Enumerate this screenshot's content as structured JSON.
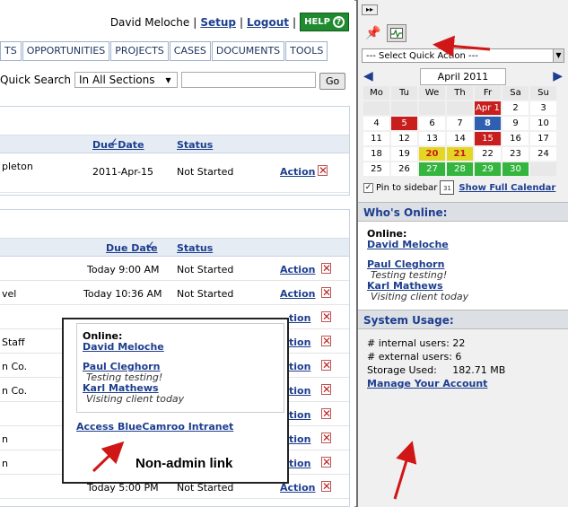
{
  "topbar": {
    "user": "David Meloche",
    "sep": "|",
    "setup": "Setup",
    "logout": "Logout",
    "help": "HELP"
  },
  "tabs": [
    "TS",
    "OPPORTUNITIES",
    "PROJECTS",
    "CASES",
    "DOCUMENTS",
    "TOOLS"
  ],
  "quick_search": {
    "label": "Quick Search",
    "scope": "In All Sections",
    "go": "Go"
  },
  "panel1": {
    "headers": {
      "due": "Due Date",
      "status": "Status"
    },
    "rows": [
      {
        "name": "pleton",
        "due": "2011-Apr-15",
        "status": "Not Started",
        "action": "Action"
      }
    ]
  },
  "panel2": {
    "headers": {
      "due": "Due Date",
      "status": "Status"
    },
    "rows": [
      {
        "name": "",
        "due": "Today 9:00 AM",
        "status": "Not Started",
        "action": "Action"
      },
      {
        "name": "vel",
        "due": "Today 10:36 AM",
        "status": "Not Started",
        "action": "Action"
      },
      {
        "name": "",
        "due": "",
        "status": "",
        "action": "tion"
      },
      {
        "name": "Staff",
        "due": "",
        "status": "",
        "action": "tion"
      },
      {
        "name": "n Co.",
        "due": "",
        "status": "",
        "action": "tion"
      },
      {
        "name": "n Co.",
        "due": "",
        "status": "",
        "action": "tion"
      },
      {
        "name": "",
        "due": "",
        "status": "",
        "action": "tion"
      },
      {
        "name": "n",
        "due": "",
        "status": "",
        "action": "tion"
      },
      {
        "name": "n",
        "due": "",
        "status": "",
        "action": "tion"
      },
      {
        "name": "",
        "due": "Today 5:00 PM",
        "status": "Not Started",
        "action": "Action"
      }
    ]
  },
  "sidebar": {
    "quick_action": "--- Select Quick Action ---",
    "month": "April 2011",
    "weekdays": [
      "Mo",
      "Tu",
      "We",
      "Th",
      "Fr",
      "Sa",
      "Su"
    ],
    "weeks": [
      [
        [
          "",
          "prev"
        ],
        [
          "",
          "prev"
        ],
        [
          "",
          "prev"
        ],
        [
          "",
          "prev"
        ],
        [
          "Apr 1",
          "red"
        ],
        [
          "2",
          ""
        ],
        [
          "3",
          ""
        ]
      ],
      [
        [
          "4",
          ""
        ],
        [
          "5",
          "red"
        ],
        [
          "6",
          ""
        ],
        [
          "7",
          ""
        ],
        [
          "8",
          "blue"
        ],
        [
          "9",
          ""
        ],
        [
          "10",
          ""
        ]
      ],
      [
        [
          "11",
          ""
        ],
        [
          "12",
          ""
        ],
        [
          "13",
          ""
        ],
        [
          "14",
          ""
        ],
        [
          "15",
          "red"
        ],
        [
          "16",
          ""
        ],
        [
          "17",
          ""
        ]
      ],
      [
        [
          "18",
          ""
        ],
        [
          "19",
          ""
        ],
        [
          "20",
          "yel"
        ],
        [
          "21",
          "yel"
        ],
        [
          "22",
          ""
        ],
        [
          "23",
          ""
        ],
        [
          "24",
          ""
        ]
      ],
      [
        [
          "25",
          ""
        ],
        [
          "26",
          ""
        ],
        [
          "27",
          "grn"
        ],
        [
          "28",
          "grn"
        ],
        [
          "29",
          "grn"
        ],
        [
          "30",
          "grn"
        ],
        [
          "",
          "hol"
        ]
      ]
    ],
    "pin_label": "Pin to sidebar",
    "show_calendar": "Show Full Calendar",
    "whos_online": "Who's Online:",
    "online_label": "Online:",
    "users": [
      {
        "name": "David Meloche",
        "note": ""
      },
      {
        "name": "Paul Cleghorn",
        "note": "Testing testing!"
      },
      {
        "name": "Karl Mathews",
        "note": "Visiting client today"
      }
    ],
    "system_usage": "System Usage:",
    "internal_users": "# internal users:  22",
    "external_users": "# external users: 6",
    "storage_label": "Storage Used:",
    "storage_value": "182.71 MB",
    "manage_account": "Manage Your Account"
  },
  "popup": {
    "online_label": "Online:",
    "users": [
      {
        "name": "David Meloche",
        "note": ""
      },
      {
        "name": "Paul Cleghorn",
        "note": "Testing testing!"
      },
      {
        "name": "Karl Mathews",
        "note": "Visiting client today"
      }
    ],
    "intranet_link": "Access BlueCamroo Intranet",
    "note": "Non-admin link"
  }
}
